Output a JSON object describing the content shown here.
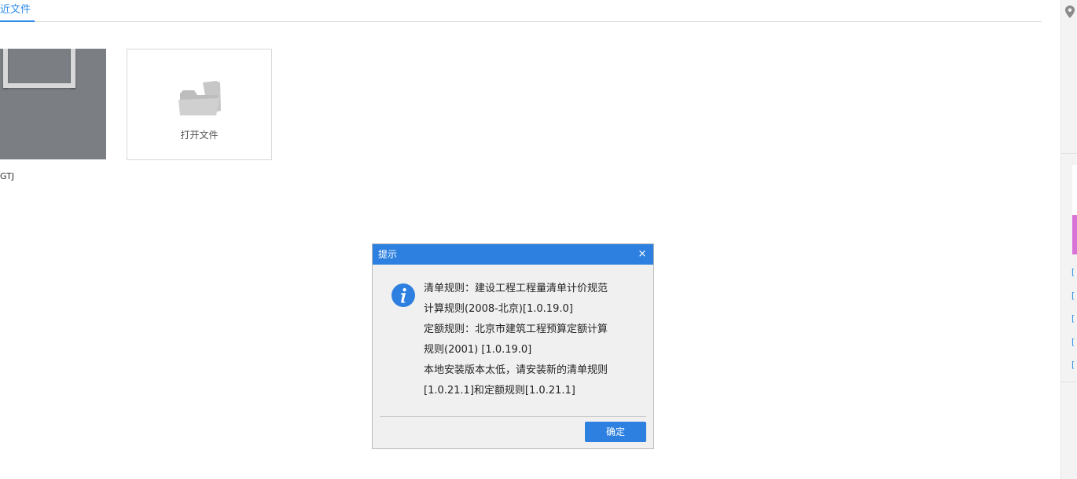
{
  "tabs": {
    "recent_files_label": "近文件"
  },
  "recent_file": {
    "name": "GTJ"
  },
  "open_file": {
    "label": "打开文件",
    "icon": "folder-icon"
  },
  "dialog": {
    "title": "提示",
    "close_glyph": "×",
    "icon": "info-icon",
    "lines": [
      "清单规则：建设工程工程量清单计价规范",
      "计算规则(2008-北京)[1.0.19.0]",
      "定额规则：北京市建筑工程预算定额计算",
      "规则(2001) [1.0.19.0]",
      "本地安装版本太低，请安装新的清单规则",
      "[1.0.21.1]和定额规则[1.0.21.1]"
    ],
    "ok_label": "确定"
  },
  "sidebar_right": {
    "pin_icon": "location-pin-icon",
    "links": [
      "[",
      "[",
      "[",
      "[",
      "["
    ]
  },
  "colors": {
    "accent": "#2d80e0",
    "tab_accent": "#2d8ceb",
    "thumbnail_bg": "#7b7f84",
    "pink_block": "#d873d8"
  }
}
